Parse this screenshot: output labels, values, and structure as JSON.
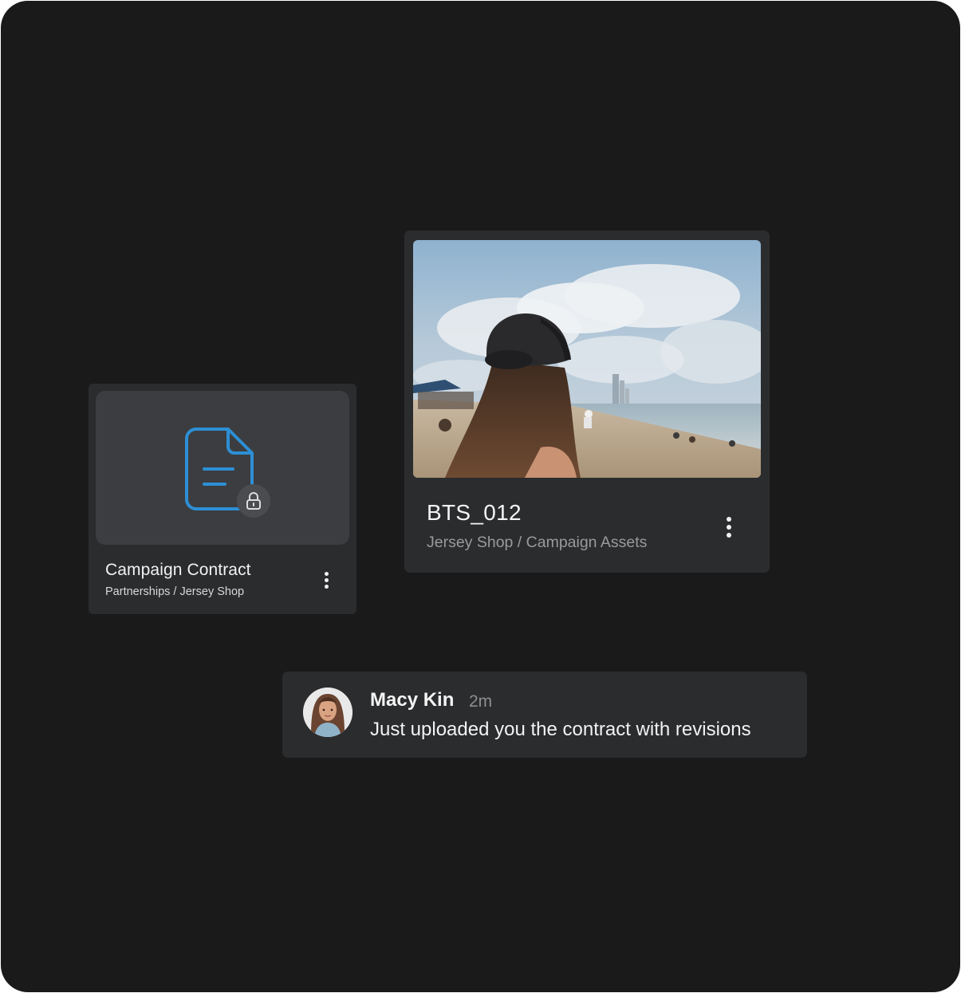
{
  "cards": {
    "contract": {
      "title": "Campaign Contract",
      "path": "Partnerships / Jersey Shop",
      "icon": "document-icon",
      "badge_icon": "lock-icon",
      "accent_color": "#2d8fd5"
    },
    "photo": {
      "title": "BTS_012",
      "path": "Jersey Shop / Campaign Assets",
      "image": "beach-photo"
    }
  },
  "message": {
    "author": "Macy Kin",
    "time": "2m",
    "text": "Just uploaded you the contract with revisions"
  },
  "colors": {
    "background": "#1a1a1a",
    "card": "#2b2c2e",
    "preview": "#3c3d40"
  }
}
